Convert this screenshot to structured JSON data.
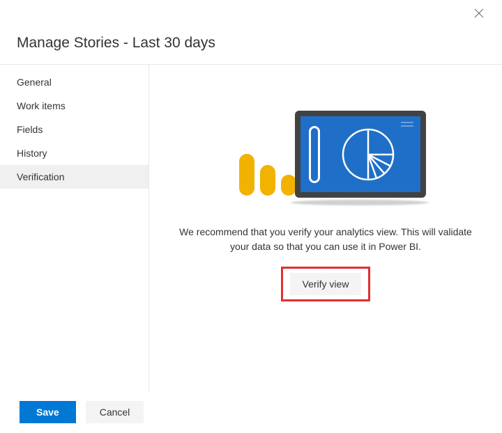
{
  "header": {
    "title": "Manage Stories - Last 30 days"
  },
  "sidebar": {
    "items": [
      {
        "label": "General",
        "active": false
      },
      {
        "label": "Work items",
        "active": false
      },
      {
        "label": "Fields",
        "active": false
      },
      {
        "label": "History",
        "active": false
      },
      {
        "label": "Verification",
        "active": true
      }
    ]
  },
  "main": {
    "description": "We recommend that you verify your analytics view. This will validate your data so that you can use it in Power BI.",
    "verify_label": "Verify view"
  },
  "footer": {
    "save_label": "Save",
    "cancel_label": "Cancel"
  }
}
